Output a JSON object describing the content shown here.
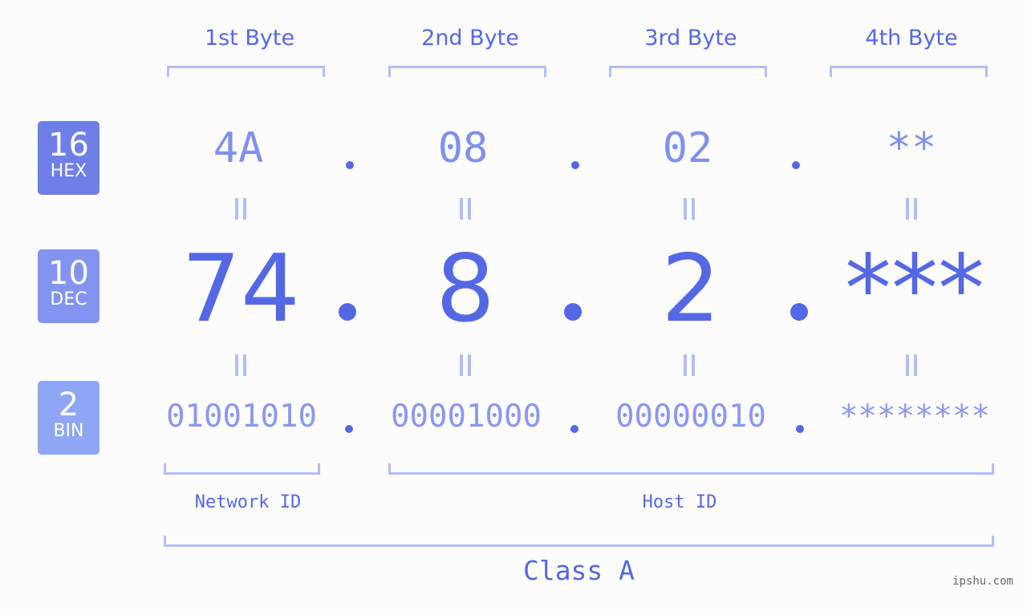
{
  "byte_headers": [
    "1st Byte",
    "2nd Byte",
    "3rd Byte",
    "4th Byte"
  ],
  "badges": {
    "hex": {
      "num": "16",
      "label": "HEX",
      "color": "#6f7fe8"
    },
    "dec": {
      "num": "10",
      "label": "DEC",
      "color": "#8394f0"
    },
    "bin": {
      "num": "2",
      "label": "BIN",
      "color": "#8fa6f6"
    }
  },
  "hex": [
    "4A",
    "08",
    "02",
    "**"
  ],
  "dec": [
    "74",
    "8",
    "2",
    "***"
  ],
  "bin": [
    "01001010",
    "00001000",
    "00000010",
    "********"
  ],
  "labels": {
    "network_id": "Network ID",
    "host_id": "Host ID",
    "class": "Class A"
  },
  "watermark": "ipshu.com",
  "colors": {
    "accent": "#5468e6",
    "light": "#b4bdf5",
    "mid": "#8090ee"
  }
}
